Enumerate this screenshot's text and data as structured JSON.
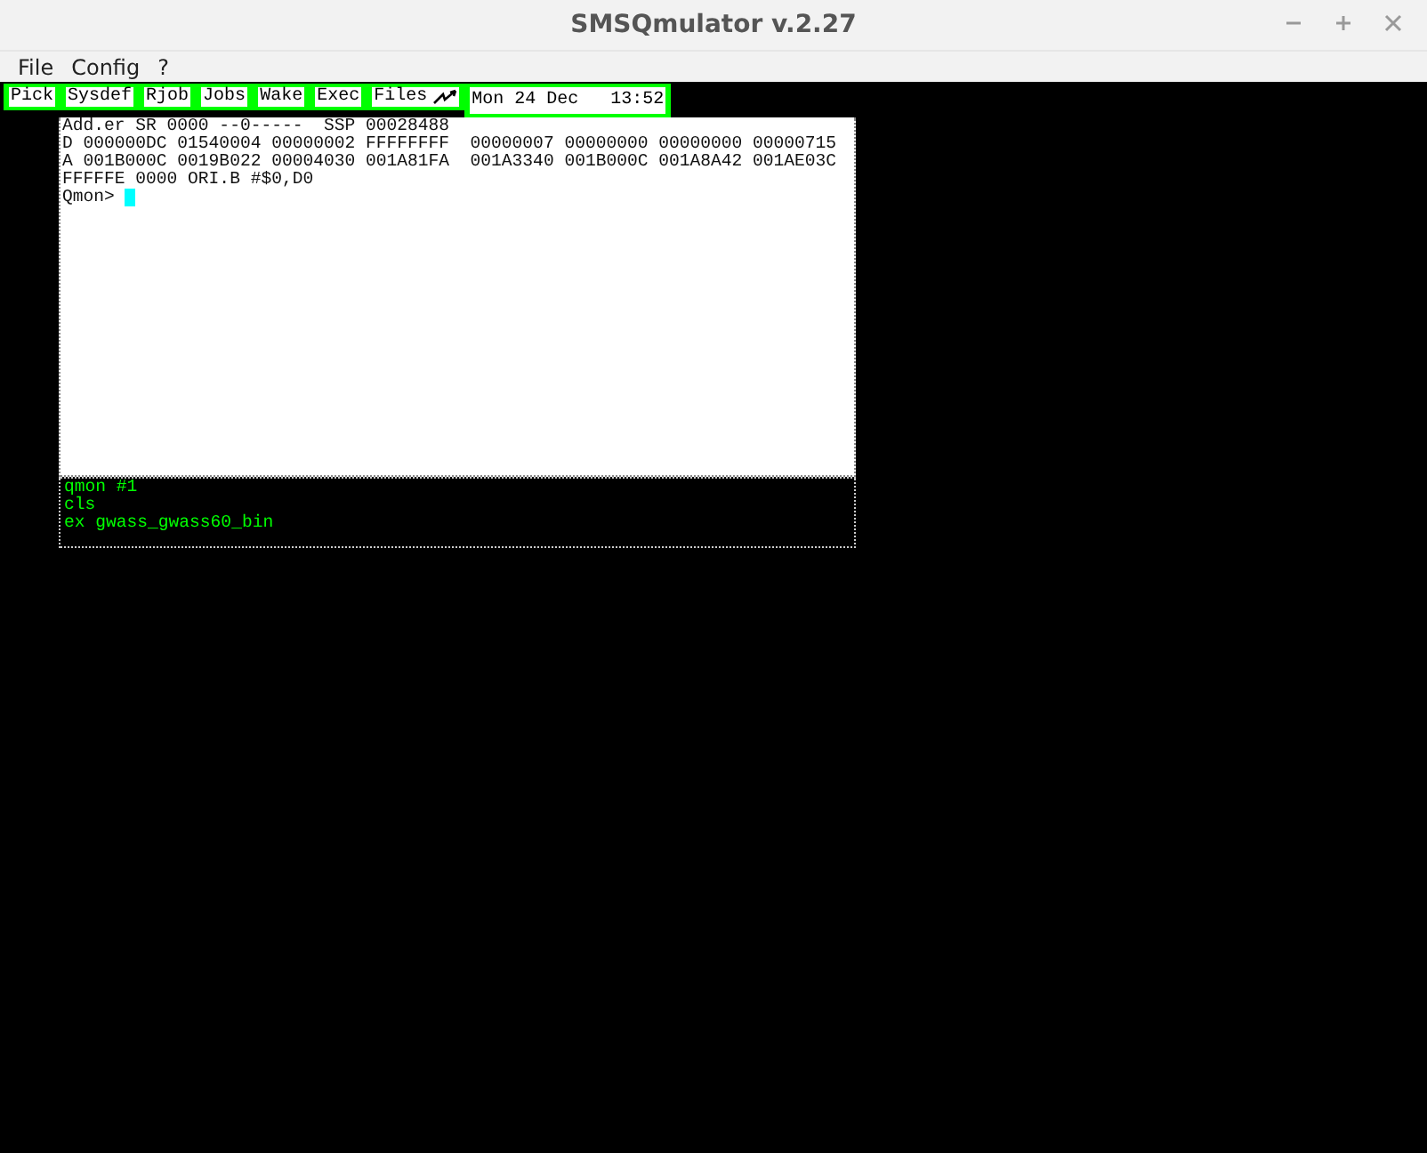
{
  "window": {
    "title": "SMSQmulator v.2.27"
  },
  "menu": [
    "File",
    "Config",
    "?"
  ],
  "button_bar": [
    {
      "label": "Pick",
      "kind": "text"
    },
    {
      "label": "Sysdef",
      "kind": "text"
    },
    {
      "label": "Rjob",
      "kind": "text"
    },
    {
      "label": "Jobs",
      "kind": "text"
    },
    {
      "label": "Wake",
      "kind": "text"
    },
    {
      "label": "Exec",
      "kind": "text"
    },
    {
      "label": "Files",
      "kind": "files"
    },
    {
      "label": "Mon 24 Dec   13:52",
      "kind": "clock"
    }
  ],
  "monitor_output": [
    "Add.er SR 0000 --0-----  SSP 00028488",
    "D 000000DC 01540004 00000002 FFFFFFFF  00000007 00000000 00000000 00000715",
    "A 001B000C 0019B022 00004030 001A81FA  001A3340 001B000C 001A8A42 001AE03C",
    "FFFFFE 0000 ORI.B #$0,D0"
  ],
  "prompt": "Qmon>",
  "command_lines": [
    "qmon #1",
    "cls",
    "ex gwass_gwass60_bin"
  ]
}
